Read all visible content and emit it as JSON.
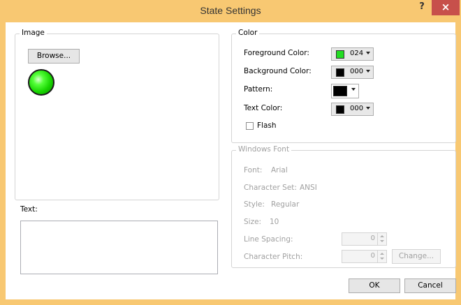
{
  "window": {
    "title": "State Settings",
    "help_label": "?",
    "close_label": "×"
  },
  "image_group": {
    "label": "Image",
    "browse_label": "Browse..."
  },
  "text_section": {
    "label": "Text:",
    "value": ""
  },
  "color_group": {
    "label": "Color",
    "foreground": {
      "label": "Foreground Color:",
      "value": "024",
      "color": "#22dd22"
    },
    "background": {
      "label": "Background Color:",
      "value": "000",
      "color": "#000000"
    },
    "pattern": {
      "label": "Pattern:",
      "color": "#000000"
    },
    "text_color": {
      "label": "Text Color:",
      "value": "000",
      "color": "#000000"
    },
    "flash": {
      "label": "Flash",
      "checked": false
    }
  },
  "font_group": {
    "label": "Windows Font",
    "font": {
      "label": "Font:",
      "value": "Arial"
    },
    "charset": {
      "label": "Character Set:",
      "value": "ANSI"
    },
    "style": {
      "label": "Style:",
      "value": "Regular"
    },
    "size": {
      "label": "Size:",
      "value": "10"
    },
    "line_spacing": {
      "label": "Line Spacing:",
      "value": "0"
    },
    "char_pitch": {
      "label": "Character Pitch:",
      "value": "0"
    },
    "change_label": "Change..."
  },
  "footer": {
    "ok_label": "OK",
    "cancel_label": "Cancel"
  }
}
